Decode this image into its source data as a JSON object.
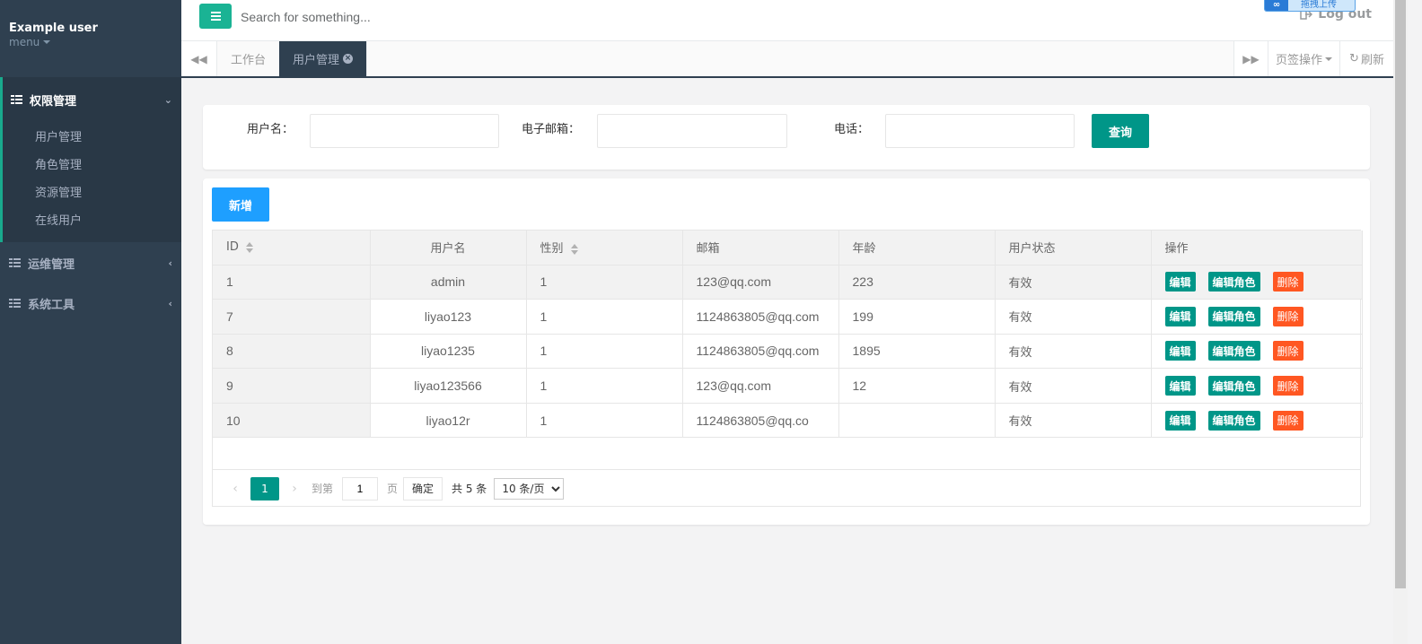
{
  "sidebar": {
    "user_name": "Example user",
    "menu_label": "menu",
    "groups": [
      {
        "label": "权限管理",
        "expanded": true,
        "items": [
          "用户管理",
          "角色管理",
          "资源管理",
          "在线用户"
        ]
      },
      {
        "label": "运维管理",
        "expanded": false
      },
      {
        "label": "系统工具",
        "expanded": false
      }
    ]
  },
  "header": {
    "search_placeholder": "Search for something...",
    "logout_label": "Log out",
    "upload_badge": "拖拽上传"
  },
  "tabs": {
    "items": [
      {
        "label": "工作台",
        "active": false
      },
      {
        "label": "用户管理",
        "active": true
      }
    ],
    "page_ops_label": "页签操作",
    "refresh_label": "刷新"
  },
  "search_form": {
    "username_label": "用户名：",
    "email_label": "电子邮箱：",
    "phone_label": "电话：",
    "query_label": "查询"
  },
  "table": {
    "add_label": "新增",
    "columns": [
      "ID",
      "用户名",
      "性别",
      "邮箱",
      "年龄",
      "用户状态",
      "操作"
    ],
    "rows": [
      {
        "id": "1",
        "username": "admin",
        "gender": "1",
        "email": "123@qq.com",
        "age": "223",
        "status": "有效"
      },
      {
        "id": "7",
        "username": "liyao123",
        "gender": "1",
        "email": "1124863805@qq.com",
        "age": "199",
        "status": "有效"
      },
      {
        "id": "8",
        "username": "liyao1235",
        "gender": "1",
        "email": "1124863805@qq.com",
        "age": "1895",
        "status": "有效"
      },
      {
        "id": "9",
        "username": "liyao123566",
        "gender": "1",
        "email": "123@qq.com",
        "age": "12",
        "status": "有效"
      },
      {
        "id": "10",
        "username": "liyao12r",
        "gender": "1",
        "email": "1124863805@qq.co",
        "age": "",
        "status": "有效"
      }
    ],
    "actions": {
      "edit": "编辑",
      "edit_role": "编辑角色",
      "delete": "删除"
    }
  },
  "pager": {
    "current_page": "1",
    "goto_label": "到第",
    "goto_value": "1",
    "page_label": "页",
    "confirm_label": "确定",
    "total_label": "共 5 条",
    "page_size": "10 条/页"
  },
  "colors": {
    "sidebar_bg": "#2f4050",
    "primary_green": "#009688",
    "accent_teal": "#1ab394",
    "add_blue": "#1e9fff",
    "danger_orange": "#ff5722"
  }
}
